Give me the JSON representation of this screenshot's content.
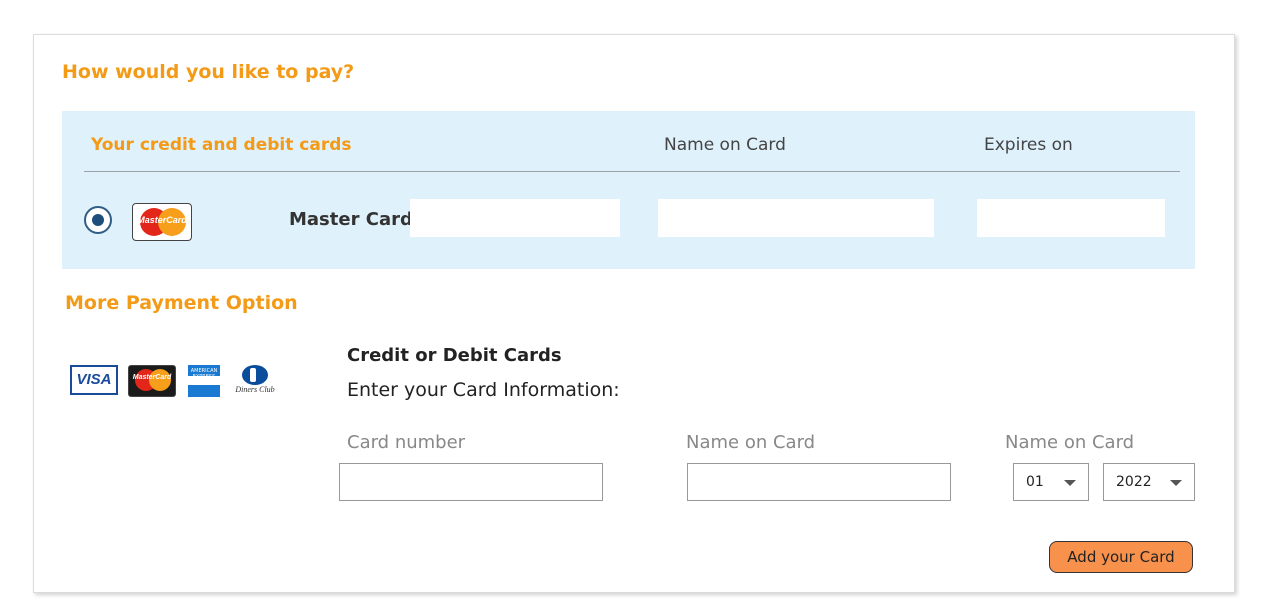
{
  "payment": {
    "title": "How would you like to pay?",
    "saved_cards": {
      "header_cards": "Your credit and debit cards",
      "header_name": "Name on Card",
      "header_expires": "Expires on",
      "selected_card": {
        "logo_text": "MasterCard",
        "label": "Master Card",
        "selected": true
      }
    },
    "more": {
      "title": "More Payment Option",
      "logos": {
        "visa": "VISA",
        "mastercard": "MasterCard",
        "amex": "AMERICAN EXPRESS",
        "diners": "Diners Club"
      },
      "section_title": "Credit or Debit Cards",
      "section_subtitle": "Enter your Card Information:",
      "fields": {
        "card_number_label": "Card number",
        "name_label": "Name on Card",
        "expiry_label": "Name on Card",
        "month_value": "01",
        "year_value": "2022"
      },
      "add_button": "Add your Card"
    }
  },
  "colors": {
    "accent": "#f39a17",
    "saved_bg": "#dff1fb",
    "button_bg": "#f7914b",
    "radio": "#1e4f7c"
  },
  "icons": {
    "radio": "radio-selected-icon",
    "mastercard": "mastercard-logo-icon",
    "visa": "visa-logo-icon",
    "amex": "amex-logo-icon",
    "diners": "diners-club-logo-icon",
    "dropdown": "chevron-down-icon"
  }
}
